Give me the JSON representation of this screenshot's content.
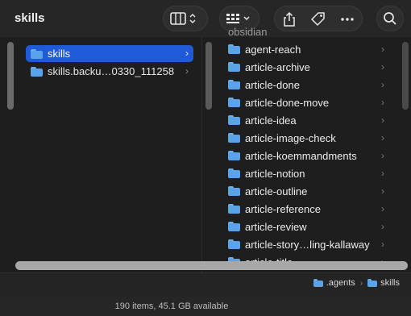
{
  "window": {
    "title": "skills"
  },
  "toolbar": {
    "view_icon": "columns-view-icon",
    "group_icon": "grid-group-icon",
    "share_icon": "share-icon",
    "tag_icon": "tag-icon",
    "more_icon": "ellipsis-icon",
    "search_icon": "search-icon"
  },
  "column1": {
    "items": [
      {
        "label": "skills",
        "selected": true
      },
      {
        "label": "skills.backu…0330_111258",
        "selected": false
      }
    ]
  },
  "column2": {
    "partial_top": "obsidian",
    "items": [
      {
        "label": "agent-reach"
      },
      {
        "label": "article-archive"
      },
      {
        "label": "article-done"
      },
      {
        "label": "article-done-move"
      },
      {
        "label": "article-idea"
      },
      {
        "label": "article-image-check"
      },
      {
        "label": "article-koemmandments"
      },
      {
        "label": "article-notion"
      },
      {
        "label": "article-outline"
      },
      {
        "label": "article-reference"
      },
      {
        "label": "article-review"
      },
      {
        "label": "article-story…ling-kallaway"
      },
      {
        "label": "article-title"
      }
    ]
  },
  "pathbar": {
    "crumbs": [
      ".agents",
      "skills"
    ]
  },
  "status": {
    "text": "190 items, 45.1 GB available"
  },
  "colors": {
    "accent": "#1f5bd6",
    "folder": "#5aa3ea"
  }
}
